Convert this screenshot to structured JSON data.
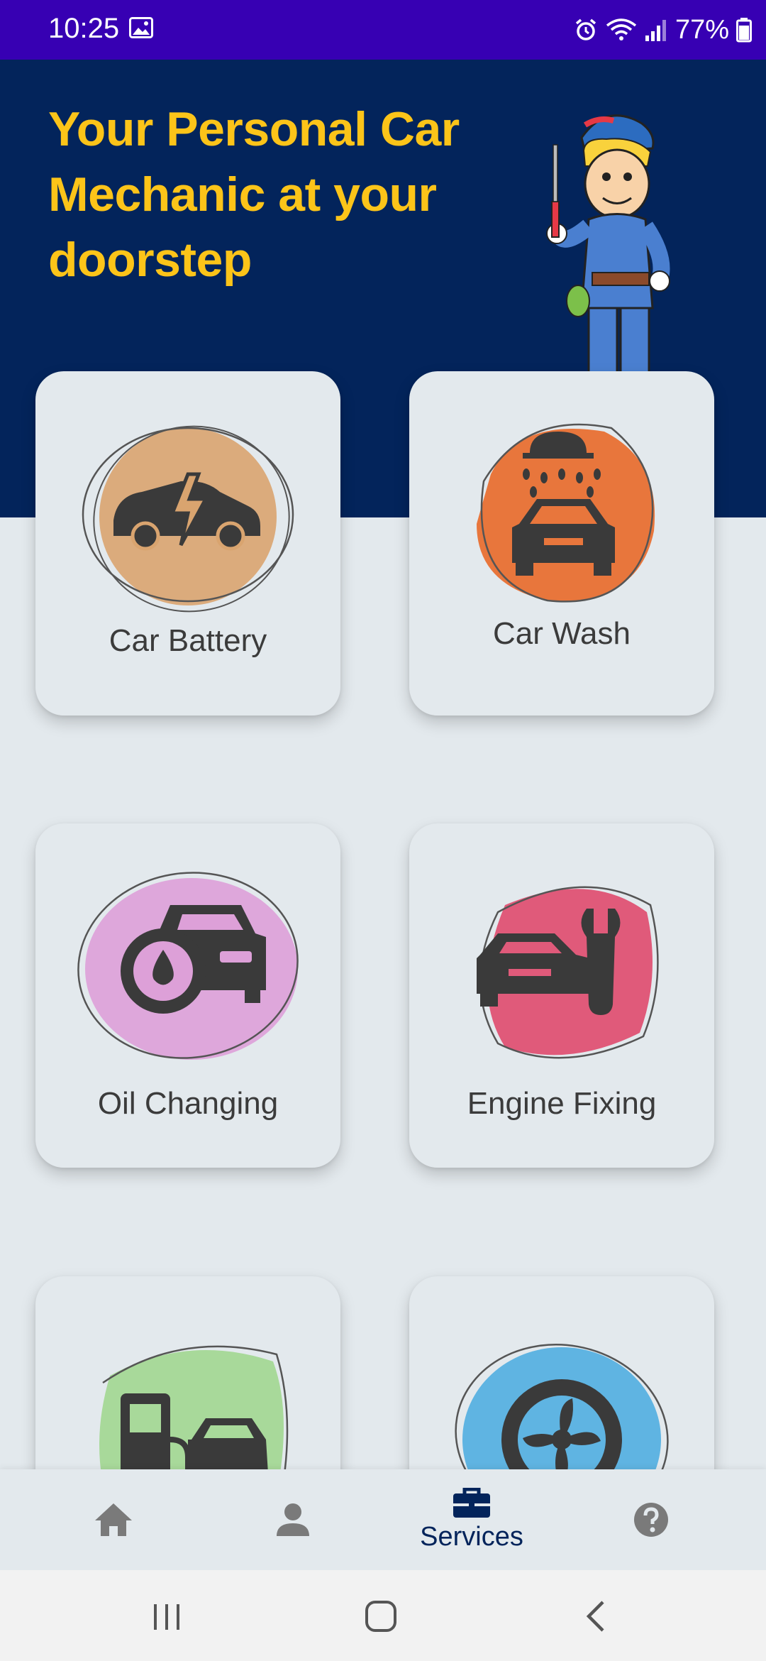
{
  "status_bar": {
    "time": "10:25",
    "battery": "77%",
    "background": "#3700b3"
  },
  "hero": {
    "title": "Your Personal Car Mechanic at your doorstep",
    "background": "#03245b",
    "title_color": "#fcc419"
  },
  "services": [
    {
      "label": "Car Battery",
      "icon": "car-battery-icon",
      "blob_color": "#d9a46f"
    },
    {
      "label": "Car Wash",
      "icon": "car-wash-icon",
      "blob_color": "#e8763c"
    },
    {
      "label": "Oil Changing",
      "icon": "oil-changing-icon",
      "blob_color": "#dda0d8"
    },
    {
      "label": "Engine Fixing",
      "icon": "engine-fixing-icon",
      "blob_color": "#e05a7a"
    },
    {
      "label": "",
      "icon": "fuel-station-icon",
      "blob_color": "#a8d99a"
    },
    {
      "label": "",
      "icon": "tyre-icon",
      "blob_color": "#5fb4e2"
    }
  ],
  "bottom_nav": {
    "items": [
      {
        "name": "home",
        "icon": "home-icon",
        "label": ""
      },
      {
        "name": "profile",
        "icon": "person-icon",
        "label": ""
      },
      {
        "name": "services",
        "icon": "toolbox-icon",
        "label": "Services",
        "active": true
      },
      {
        "name": "help",
        "icon": "help-icon",
        "label": ""
      }
    ],
    "active_color": "#03245b",
    "inactive_color": "#7a7a7a"
  },
  "system_nav": {
    "buttons": [
      "recent-apps-icon",
      "home-circle-icon",
      "back-icon"
    ]
  }
}
